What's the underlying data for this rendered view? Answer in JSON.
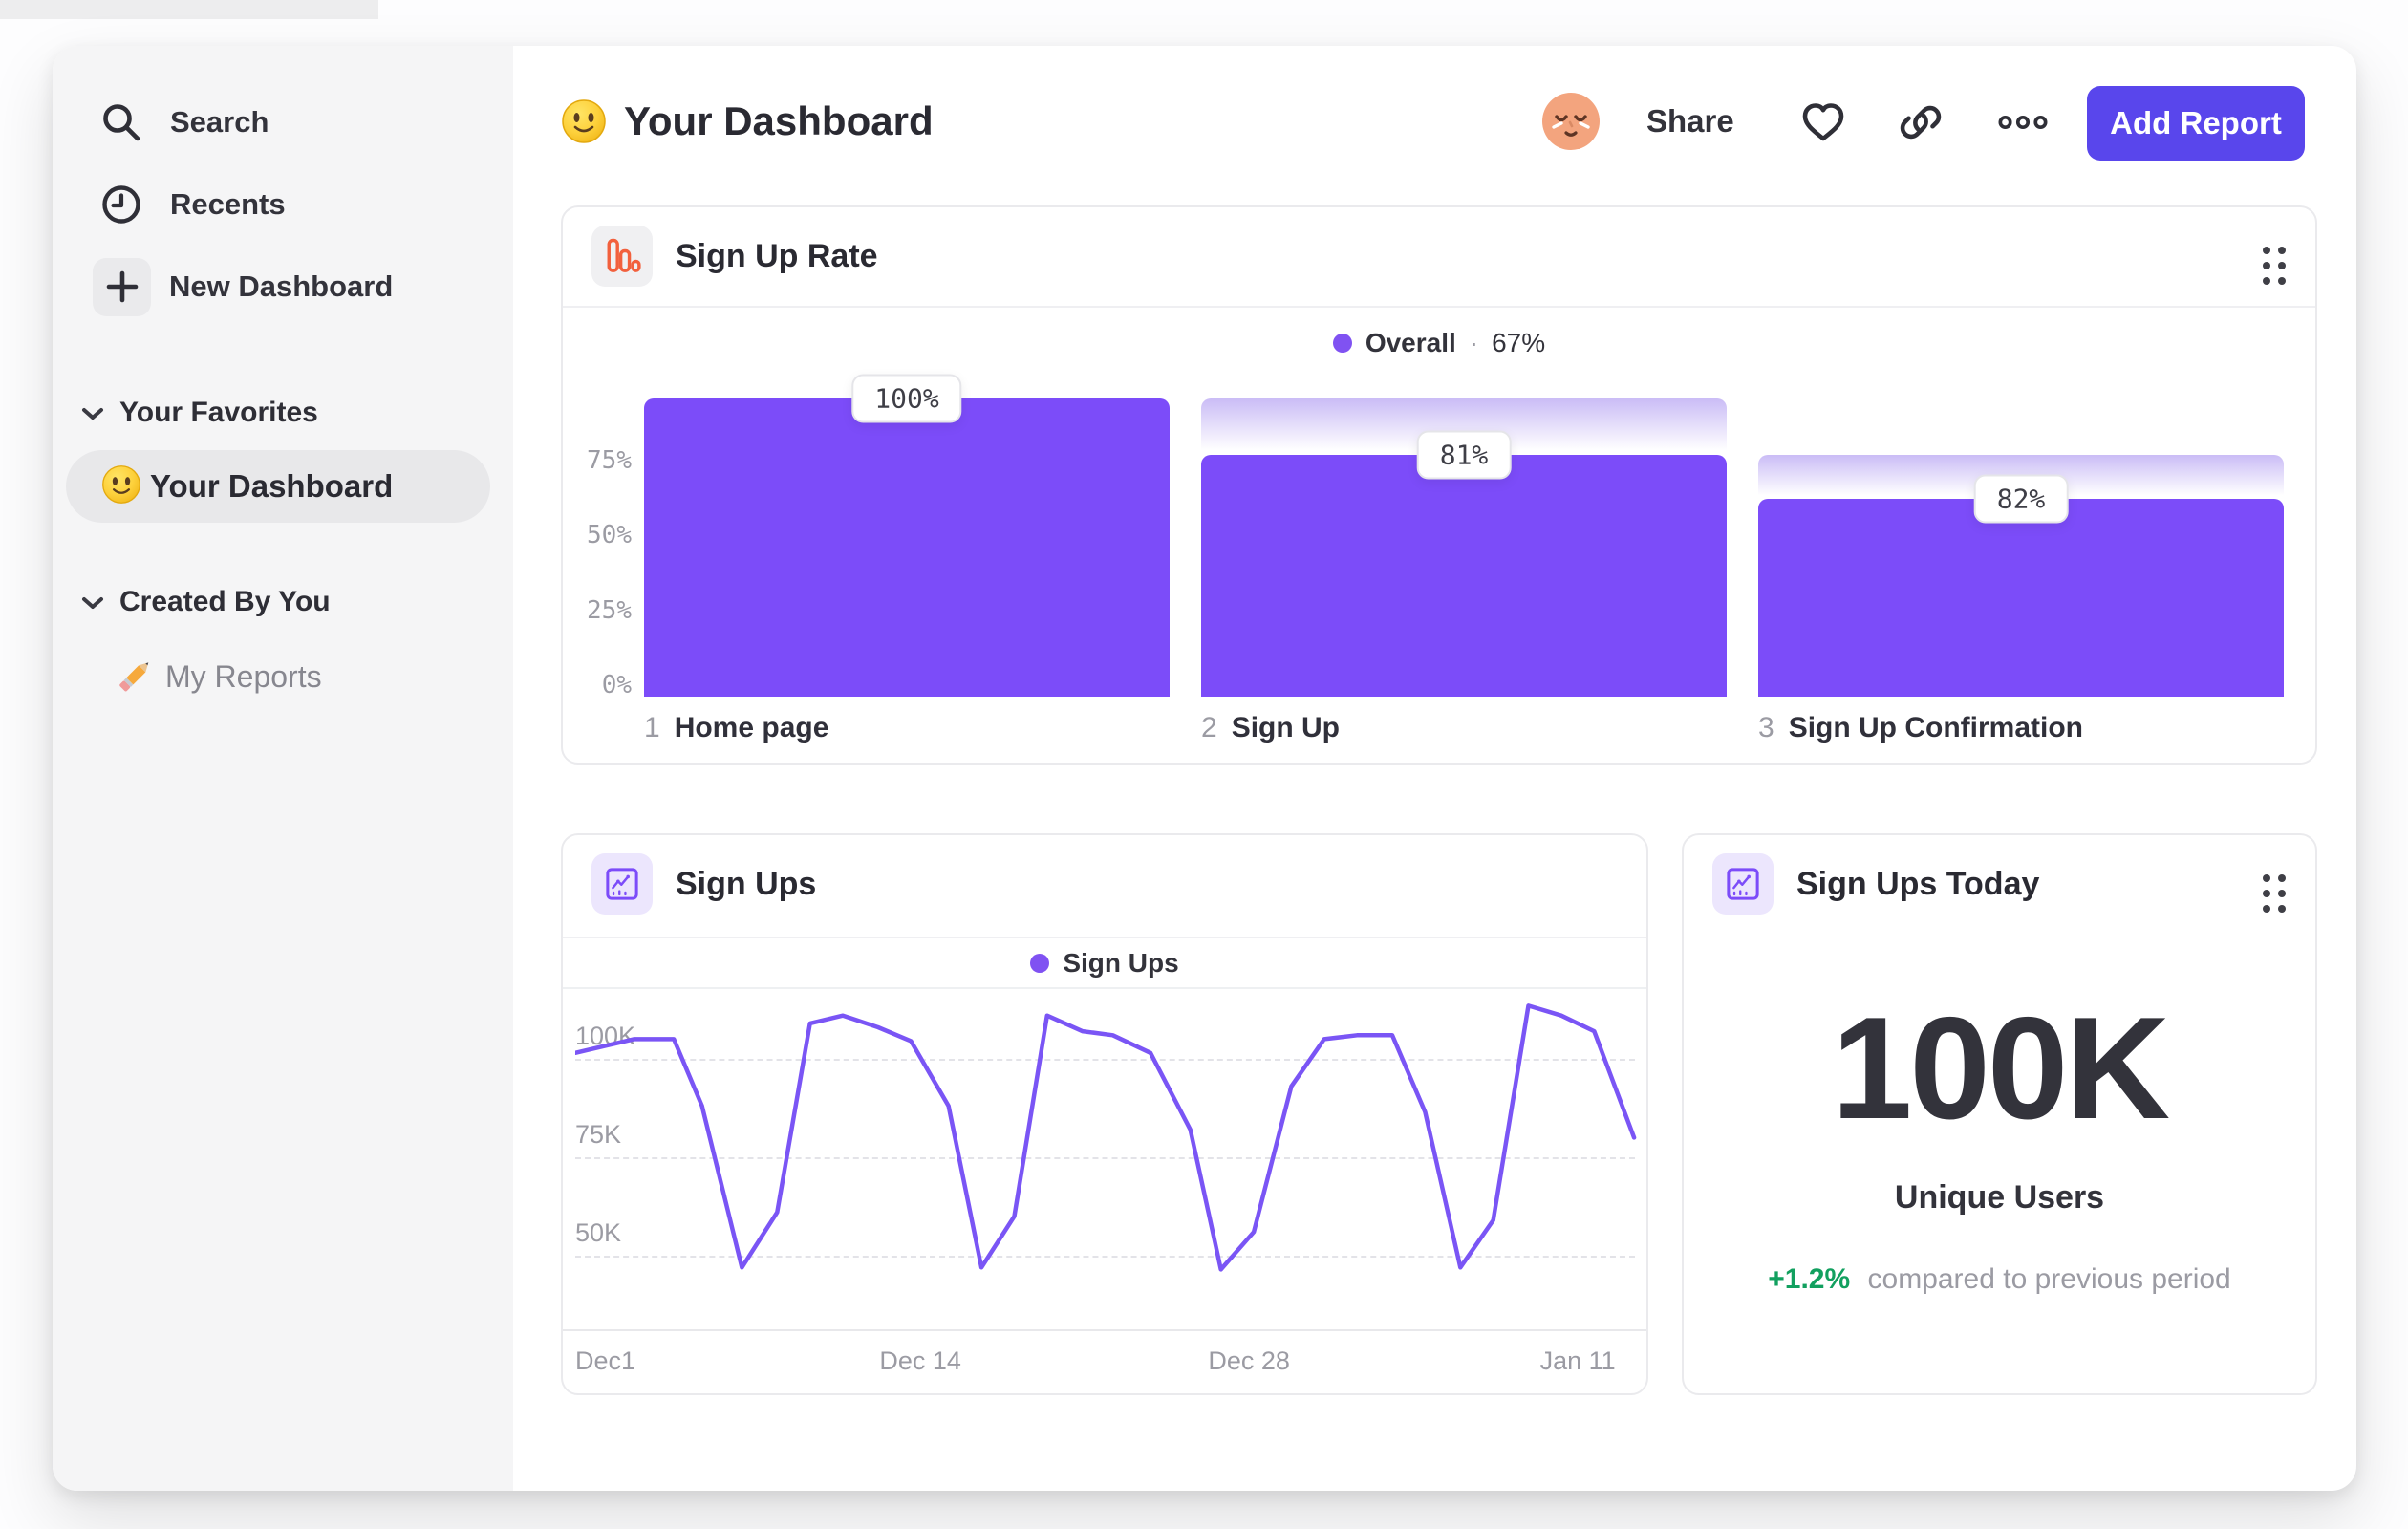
{
  "sidebar": {
    "items": [
      {
        "label": "Search",
        "icon": "search-icon"
      },
      {
        "label": "Recents",
        "icon": "clock-icon"
      },
      {
        "label": "New Dashboard",
        "icon": "plus-icon"
      }
    ],
    "sections": [
      {
        "label": "Your Favorites",
        "items": [
          {
            "label": "Your Dashboard",
            "icon": "smiley-emoji",
            "active": true
          }
        ]
      },
      {
        "label": "Created By You",
        "items": [
          {
            "label": "My Reports",
            "icon": "pencil-emoji",
            "active": false
          }
        ]
      }
    ]
  },
  "header": {
    "title": "Your Dashboard",
    "title_emoji": "smiley-emoji",
    "share_label": "Share",
    "add_report_label": "Add Report"
  },
  "icons": {
    "search-icon": "magnifier",
    "clock-icon": "clock",
    "plus-icon": "plus",
    "chevron-down-icon": "chevron-down",
    "heart-icon": "heart-outline",
    "link-icon": "chain-link",
    "more-icon": "three-rings-ellipsis",
    "drag-handle-icon": "six-dot-grip",
    "funnel-chart-icon": "orange-bar-chart",
    "line-chart-icon": "purple-line-chart",
    "avatar": "peach-face-avatar"
  },
  "colors": {
    "accent_purple": "#7c4cf9",
    "line_purple": "#7a55f5",
    "button_indigo": "#5946ec",
    "ghost_gradient_top": "#cabcf6",
    "green_delta": "#12a05f",
    "orange_icon": "#f2603d",
    "sidebar_bg": "#f5f5f6",
    "text_dark": "#2a2a32",
    "text_gray": "#9b9ba3"
  },
  "chart_data": [
    {
      "id": "signup-rate-funnel",
      "type": "bar",
      "title": "Sign Up Rate",
      "legend": {
        "label": "Overall",
        "separator": "·",
        "value": "67%"
      },
      "categories": [
        "Home page",
        "Sign Up",
        "Sign Up Confirmation"
      ],
      "step_numbers": [
        "1",
        "2",
        "3"
      ],
      "values_pct": [
        100,
        81,
        66.4
      ],
      "ghost_top_pct": [
        null,
        100,
        81
      ],
      "data_labels": [
        "100%",
        "81%",
        "82%"
      ],
      "yticks": [
        {
          "pct": 75,
          "label": "75%"
        },
        {
          "pct": 50,
          "label": "50%"
        },
        {
          "pct": 25,
          "label": "25%"
        },
        {
          "pct": 0,
          "label": "0%"
        }
      ],
      "ylim": [
        0,
        100
      ],
      "grid": false,
      "legend_position": "top-center",
      "bar_color": "#7c4cf9"
    },
    {
      "id": "sign-ups-line",
      "type": "line",
      "title": "Sign Ups",
      "legend": {
        "label": "Sign Ups"
      },
      "x_unit": "days since Dec 1",
      "points": [
        [
          -0.7,
          101.5
        ],
        [
          1.8,
          105
        ],
        [
          3.5,
          105
        ],
        [
          4.7,
          88
        ],
        [
          6.4,
          47
        ],
        [
          7.9,
          61
        ],
        [
          9.3,
          109
        ],
        [
          10.7,
          111
        ],
        [
          12.2,
          108
        ],
        [
          13.6,
          104.5
        ],
        [
          15.2,
          88
        ],
        [
          16.6,
          47
        ],
        [
          18,
          60
        ],
        [
          19.4,
          111
        ],
        [
          20.9,
          107
        ],
        [
          22.2,
          106
        ],
        [
          23.8,
          101.5
        ],
        [
          25.5,
          82
        ],
        [
          26.8,
          46.5
        ],
        [
          28.2,
          56
        ],
        [
          29.8,
          93
        ],
        [
          31.2,
          105
        ],
        [
          32.6,
          106
        ],
        [
          34.1,
          106
        ],
        [
          35.5,
          86.5
        ],
        [
          37,
          47
        ],
        [
          38.4,
          59
        ],
        [
          39.9,
          113.5
        ],
        [
          41.3,
          111
        ],
        [
          42.7,
          107
        ],
        [
          44.4,
          80
        ]
      ],
      "y_unit": "K sign ups",
      "xticks": [
        {
          "day": 0,
          "label": "Dec1"
        },
        {
          "day": 14,
          "label": "Dec 14"
        },
        {
          "day": 28,
          "label": "Dec 28"
        },
        {
          "day": 42,
          "label": "Jan 11"
        }
      ],
      "yticks": [
        {
          "value": 100,
          "label": "100K"
        },
        {
          "value": 75,
          "label": "75K"
        },
        {
          "value": 50,
          "label": "50K"
        }
      ],
      "x_domain": [
        -0.7,
        44.6
      ],
      "y_domain": [
        31.3,
        118.2
      ],
      "grid": "dashed-horizontal",
      "legend_position": "top-center",
      "line_color": "#7a55f5"
    },
    {
      "id": "sign-ups-today-metric",
      "type": "metric",
      "title": "Sign Ups Today",
      "value": "100K",
      "label": "Unique Users",
      "delta": "+1.2%",
      "delta_context": "compared to previous period",
      "delta_color": "#12a05f"
    }
  ]
}
